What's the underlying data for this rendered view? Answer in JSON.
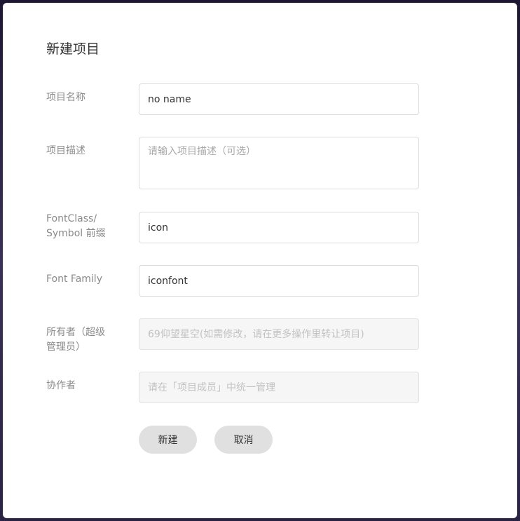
{
  "dialog": {
    "title": "新建项目",
    "fields": {
      "project_name": {
        "label": "项目名称",
        "value": "no name"
      },
      "project_desc": {
        "label": "项目描述",
        "placeholder": "请输入项目描述（可选）"
      },
      "prefix": {
        "label_line1": "FontClass/",
        "label_line2": "Symbol 前缀",
        "value": "icon"
      },
      "font_family": {
        "label": "Font Family",
        "value": "iconfont"
      },
      "owner": {
        "label_line1": "所有者（超级",
        "label_line2": "管理员）",
        "placeholder": "69仰望星空(如需修改，请在更多操作里转让项目)"
      },
      "collaborators": {
        "label": "协作者",
        "placeholder": "请在「项目成员」中统一管理"
      }
    },
    "buttons": {
      "create": "新建",
      "cancel": "取消"
    }
  }
}
